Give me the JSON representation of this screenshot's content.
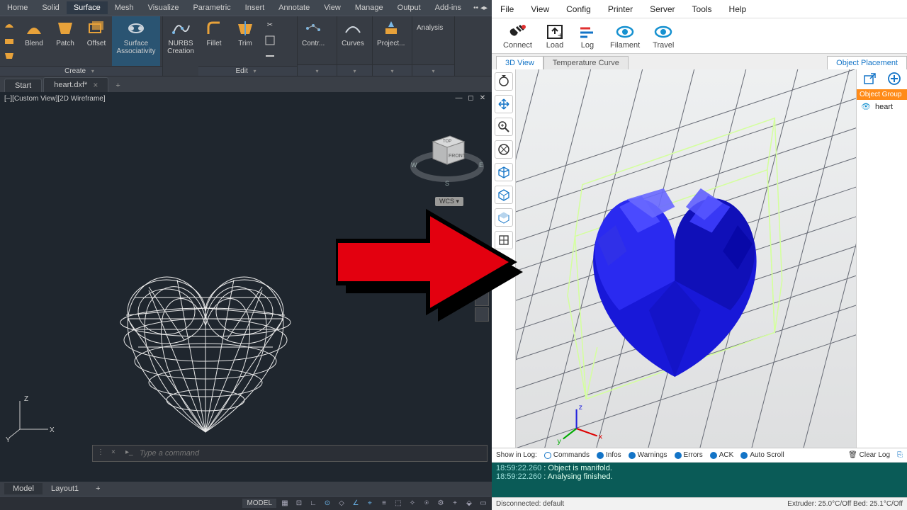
{
  "cad": {
    "menu": [
      "Home",
      "Solid",
      "Surface",
      "Mesh",
      "Visualize",
      "Parametric",
      "Insert",
      "Annotate",
      "View",
      "Manage",
      "Output",
      "Add-ins"
    ],
    "active_menu": "Surface",
    "ribbon": {
      "group_create": {
        "buttons": [
          "Blend",
          "Patch",
          "Offset",
          "Surface Associativity",
          "NURBS Creation"
        ],
        "label": "Create"
      },
      "group_edit": {
        "buttons": [
          "Fillet",
          "Trim"
        ],
        "label": "Edit"
      },
      "group_ctrl": {
        "label": "Contr..."
      },
      "group_curves": {
        "label": "Curves"
      },
      "group_project": {
        "label": "Project..."
      },
      "group_analysis": {
        "label": "Analysis"
      }
    },
    "tabs": {
      "start": "Start",
      "file": "heart.dxf*",
      "plus": "+"
    },
    "viewport_label": "[–][Custom View][2D Wireframe]",
    "wcs": "WCS",
    "compass": {
      "top": "TOP",
      "front": "FRONT",
      "w": "W",
      "e": "E",
      "s": "S"
    },
    "command_placeholder": "Type a command",
    "bottom_tabs": {
      "model": "Model",
      "layout": "Layout1"
    },
    "status_model": "MODEL",
    "axes": {
      "x": "X",
      "y": "Y",
      "z": "Z"
    }
  },
  "slicer": {
    "menu": [
      "File",
      "View",
      "Config",
      "Printer",
      "Server",
      "Tools",
      "Help"
    ],
    "toolbar": {
      "connect": "Connect",
      "load": "Load",
      "log": "Log",
      "filament": "Filament",
      "travel": "Travel"
    },
    "tabs": {
      "view3d": "3D View",
      "temp": "Temperature Curve"
    },
    "right": {
      "header": "Object Placement",
      "group": "Object Group",
      "item": "heart"
    },
    "log": {
      "show": "Show in Log:",
      "opts": {
        "commands": "Commands",
        "infos": "Infos",
        "warnings": "Warnings",
        "errors": "Errors",
        "ack": "ACK",
        "auto": "Auto Scroll"
      },
      "clear": "Clear Log",
      "lines": [
        {
          "ts": "18:59:22.260",
          "msg": "Object is manifold."
        },
        {
          "ts": "18:59:22.260",
          "msg": "Analysing finished."
        }
      ]
    },
    "status": {
      "left": "Disconnected: default",
      "right": "Extruder: 25.0°C/Off  Bed: 25.1°C/Off"
    },
    "axes": {
      "x": "x",
      "y": "y",
      "z": "z"
    }
  }
}
